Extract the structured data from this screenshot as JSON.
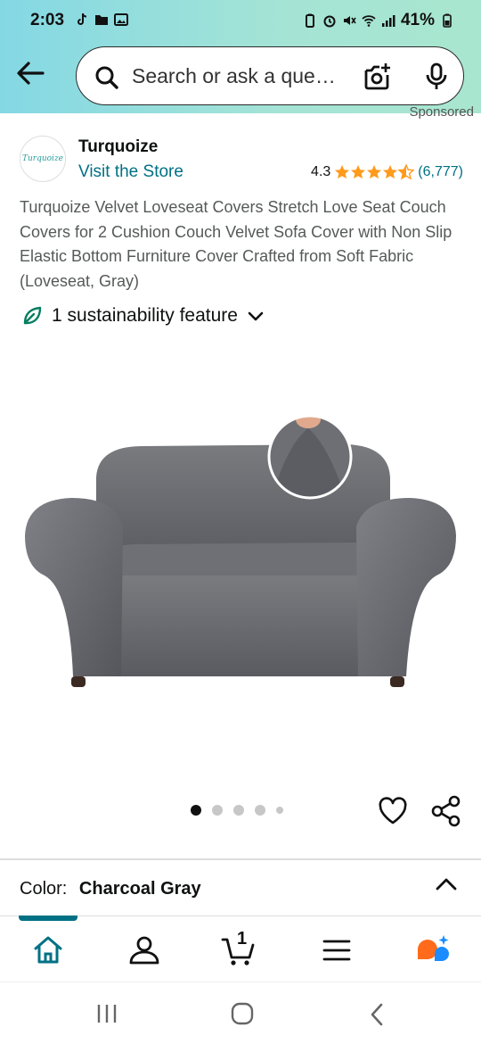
{
  "status_bar": {
    "time": "2:03",
    "battery": "41%"
  },
  "search": {
    "placeholder": "Search or ask a que…"
  },
  "sponsored_label": "Sponsored",
  "brand": {
    "logo_text": "Turquoize",
    "name": "Turquoize",
    "visit_store": "Visit the Store"
  },
  "rating": {
    "value": "4.3",
    "stars_out_of_5": 4.3,
    "count": "(6,777)"
  },
  "product": {
    "title": "Turquoize Velvet Loveseat Covers Stretch Love Seat Couch Covers for 2 Cushion Couch Velvet Sofa Cover with Non Slip Elastic Bottom Furniture Cover Crafted from Soft Fabric (Loveseat, Gray)",
    "image_count": 5,
    "active_image_index": 0
  },
  "sustainability": {
    "label": "1 sustainability feature"
  },
  "color": {
    "label": "Color:",
    "value": "Charcoal Gray"
  },
  "bottom_nav": {
    "cart_count": "1",
    "items": [
      "home",
      "account",
      "cart",
      "menu",
      "ai-assistant"
    ]
  },
  "colors": {
    "link": "#007185",
    "star": "#ff9a1c",
    "header_start": "#84d8e4",
    "header_end": "#a8e6cf"
  },
  "icons": {
    "back": "arrow-left-icon",
    "search": "search-icon",
    "camera": "camera-lens-icon",
    "mic": "microphone-icon",
    "leaf": "leaf-icon",
    "heart": "heart-icon",
    "share": "share-icon",
    "chevron": "chevron-up-icon"
  }
}
